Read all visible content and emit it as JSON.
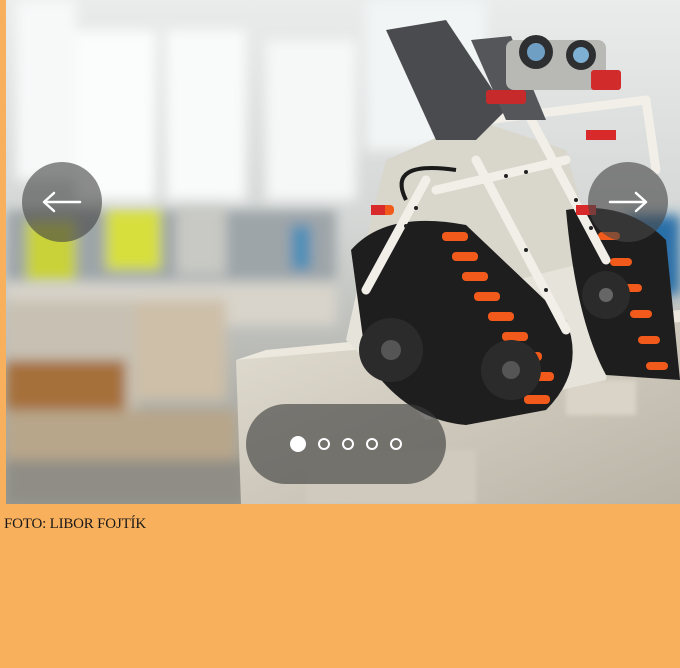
{
  "slider": {
    "prev_icon": "arrow-left-icon",
    "next_icon": "arrow-right-icon",
    "slide_count": 5,
    "active_slide": 1
  },
  "caption": {
    "credit": "FOTO: LIBOR FOJTÍK"
  },
  "colors": {
    "page_background": "#f9b05c",
    "control_background": "#464646",
    "control_foreground": "#ffffff"
  }
}
